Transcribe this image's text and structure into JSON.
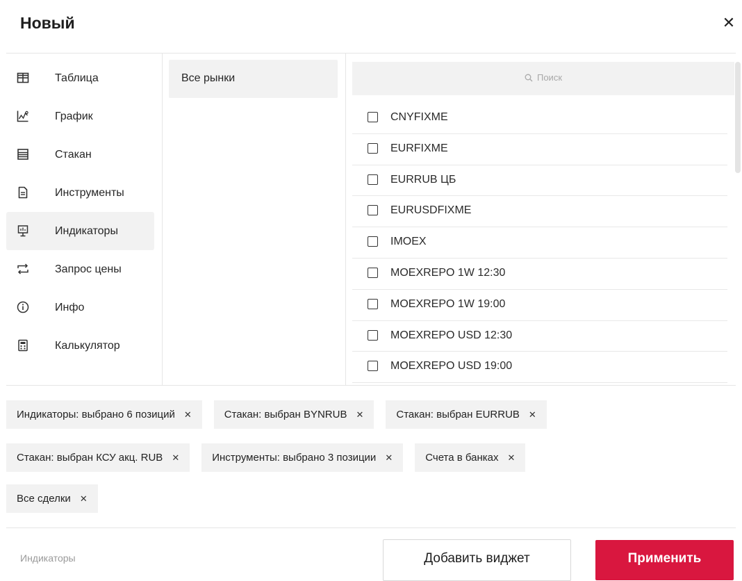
{
  "dialog": {
    "title": "Новый",
    "close_icon": "close-icon",
    "close_glyph": "✕"
  },
  "sidebar": {
    "items": [
      {
        "label": "Таблица",
        "icon": "table-icon",
        "active": false
      },
      {
        "label": "График",
        "icon": "chart-icon",
        "active": false
      },
      {
        "label": "Стакан",
        "icon": "order-book-icon",
        "active": false
      },
      {
        "label": "Инструменты",
        "icon": "document-icon",
        "active": false
      },
      {
        "label": "Индикаторы",
        "icon": "presentation-icon",
        "active": true
      },
      {
        "label": "Запрос цены",
        "icon": "swap-arrows-icon",
        "active": false
      },
      {
        "label": "Инфо",
        "icon": "info-icon",
        "active": false
      },
      {
        "label": "Калькулятор",
        "icon": "calculator-icon",
        "active": false
      }
    ]
  },
  "markets": {
    "selected": "Все рынки"
  },
  "search": {
    "placeholder": "Поиск",
    "icon": "search-icon"
  },
  "instruments": {
    "items": [
      "CNYFIXME",
      "EURFIXME",
      "EURRUB ЦБ",
      "EURUSDFIXME",
      "IMOEX",
      "MOEXREPO 1W 12:30",
      "MOEXREPO 1W 19:00",
      "MOEXREPO USD 12:30",
      "MOEXREPO USD 19:00"
    ]
  },
  "chips": {
    "rows": [
      [
        "Индикаторы: выбрано 6 позиций",
        "Стакан: выбран BYNRUB",
        "Стакан: выбран EURRUB"
      ],
      [
        "Стакан: выбран КСУ акц. RUB",
        "Инструменты: выбрано 3 позиции",
        "Счета в банках"
      ],
      [
        "Все сделки"
      ]
    ],
    "remove_glyph": "✕"
  },
  "footer": {
    "current_label": "Индикаторы",
    "add_widget_label": "Добавить виджет",
    "apply_label": "Применить"
  },
  "colors": {
    "accent": "#d9173f",
    "panel_bg": "#f2f2f2",
    "divider": "#e6e6e6"
  }
}
